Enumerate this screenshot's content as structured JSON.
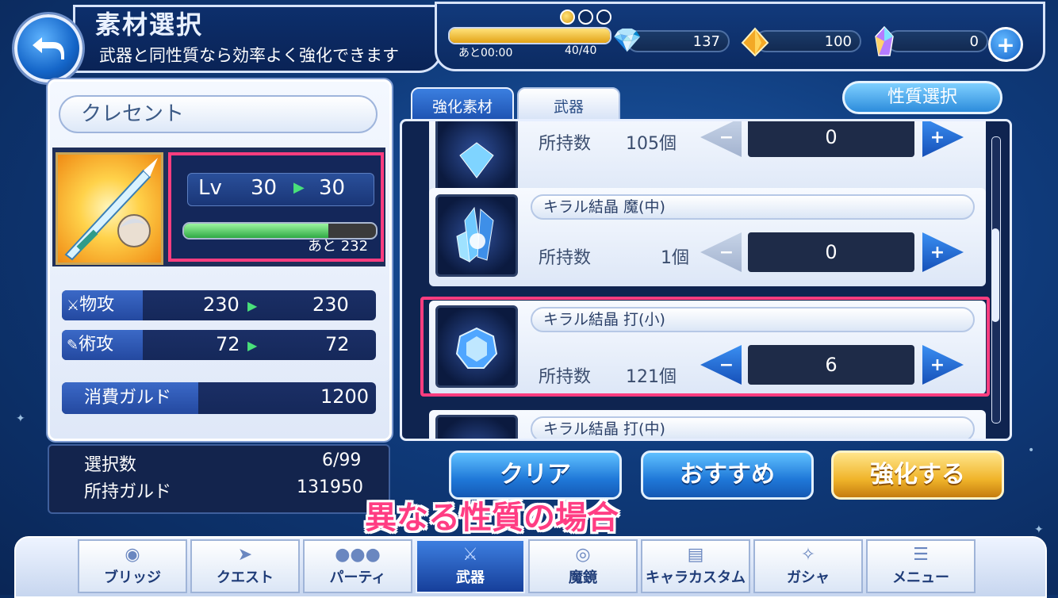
{
  "header": {
    "title": "素材選択",
    "subtitle": "武器と同性質なら効率よく強化できます"
  },
  "status": {
    "stamina_time": "あと00:00",
    "stamina_count": "40/40",
    "stamina_fill": 1.0,
    "gem_count": "137",
    "crystal_count": "100",
    "rainbow_count": "0"
  },
  "character": {
    "name": "クレセント",
    "lv_label": "Lv",
    "lv_from": "30",
    "lv_to": "30",
    "exp_rest": "あと 232",
    "exp_fill": 0.75
  },
  "stats": [
    {
      "label": "物攻",
      "from": "230",
      "to": "230"
    },
    {
      "label": "術攻",
      "from": "72",
      "to": "72"
    }
  ],
  "cost": {
    "label": "消費ガルド",
    "value": "1200"
  },
  "info": {
    "selected_label": "選択数",
    "selected_value": "6/99",
    "gold_label": "所持ガルド",
    "gold_value": "131950"
  },
  "tabs": {
    "active": "強化素材",
    "inactive": "武器",
    "trait_button": "性質選択"
  },
  "items": [
    {
      "name": "",
      "owned_label": "所持数",
      "owned": "105個",
      "qty": "0"
    },
    {
      "name": "キラル結晶 魔(中)",
      "owned_label": "所持数",
      "owned": "1個",
      "qty": "0"
    },
    {
      "name": "キラル結晶 打(小)",
      "owned_label": "所持数",
      "owned": "121個",
      "qty": "6"
    },
    {
      "name": "キラル結晶 打(中)",
      "owned_label": "",
      "owned": "",
      "qty": ""
    }
  ],
  "buttons": {
    "clear": "クリア",
    "recommend": "おすすめ",
    "enhance": "強化する"
  },
  "caption": "異なる性質の場合",
  "nav": [
    {
      "label": "ブリッジ",
      "icon": "bridge-icon"
    },
    {
      "label": "クエスト",
      "icon": "quest-icon"
    },
    {
      "label": "パーティ",
      "icon": "party-icon"
    },
    {
      "label": "武器",
      "icon": "weapon-icon"
    },
    {
      "label": "魔鏡",
      "icon": "mirror-icon"
    },
    {
      "label": "キャラカスタム",
      "icon": "custom-icon"
    },
    {
      "label": "ガシャ",
      "icon": "gacha-icon"
    },
    {
      "label": "メニュー",
      "icon": "menu-icon"
    }
  ],
  "colors": {
    "highlight": "#ff3d7f",
    "accent_blue": "#1f78d8",
    "accent_gold": "#f0b42a",
    "exp_green": "#2faa44"
  }
}
